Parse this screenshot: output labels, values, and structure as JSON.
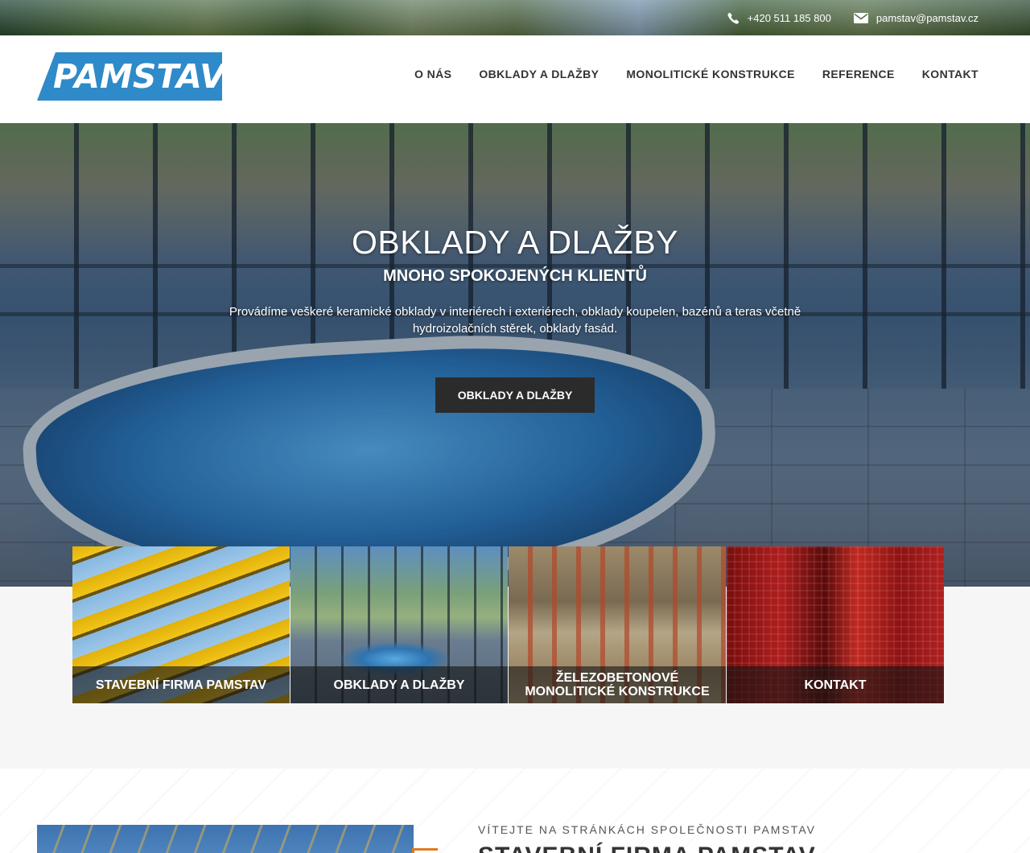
{
  "topbar": {
    "phone": "+420 511 185 800",
    "email": "pamstav@pamstav.cz",
    "phone_icon": "phone-icon",
    "email_icon": "envelope-icon"
  },
  "header": {
    "logo_text": "PAMSTAV",
    "nav": [
      {
        "label": "O NÁS"
      },
      {
        "label": "OBKLADY A DLAŽBY"
      },
      {
        "label": "MONOLITICKÉ KONSTRUKCE"
      },
      {
        "label": "REFERENCE"
      },
      {
        "label": "KONTAKT"
      }
    ]
  },
  "hero": {
    "title": "OBKLADY A DLAŽBY",
    "subtitle": "MNOHO SPOKOJENÝCH KLIENTŮ",
    "text": "Provádíme veškeré keramické obklady v interiérech i exteriérech, obklady koupelen, bazénů a teras včetně hydroizolačních stěrek, obklady fasád.",
    "button_label": "OBKLADY A DLAŽBY"
  },
  "tiles": [
    {
      "label": "STAVEBNÍ FIRMA PAMSTAV"
    },
    {
      "label": "OBKLADY A DLAŽBY"
    },
    {
      "label": "ŽELEZOBETONOVÉ MONOLITICKÉ KONSTRUKCE"
    },
    {
      "label": "KONTAKT"
    }
  ],
  "welcome": {
    "kicker": "VÍTEJTE NA STRÁNKÁCH SPOLEČNOSTI PAMSTAV",
    "heading": "STAVEBNÍ FIRMA PAMSTAV"
  },
  "colors": {
    "brand_blue": "#2f8ac9",
    "button_dark": "#2b2b2b",
    "accent_orange": "#e07a1f"
  }
}
